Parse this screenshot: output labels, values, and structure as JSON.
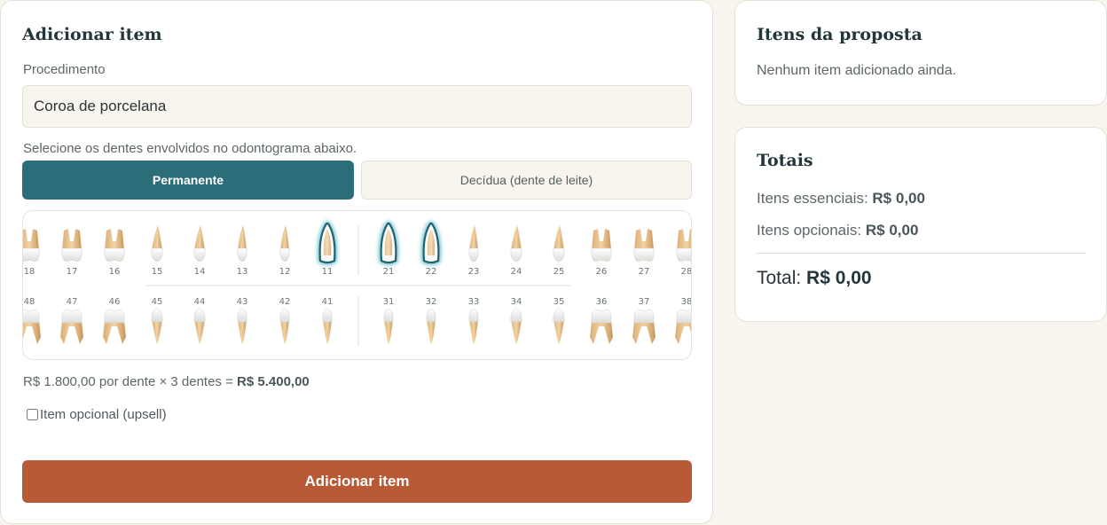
{
  "add_item": {
    "title": "Adicionar item",
    "procedure_label": "Procedimento",
    "procedure_value": "Coroa de porcelana",
    "instruction": "Selecione os dentes envolvidos no odontograma abaixo.",
    "tabs": [
      {
        "label": "Permanente",
        "active": true
      },
      {
        "label": "Decídua (dente de leite)",
        "active": false
      }
    ],
    "odontogram": {
      "upper_right": [
        "18",
        "17",
        "16",
        "15",
        "14",
        "13",
        "12",
        "11"
      ],
      "upper_left": [
        "21",
        "22",
        "23",
        "24",
        "25",
        "26",
        "27",
        "28"
      ],
      "lower_right": [
        "48",
        "47",
        "46",
        "45",
        "44",
        "43",
        "42",
        "41"
      ],
      "lower_left": [
        "31",
        "32",
        "33",
        "34",
        "35",
        "36",
        "37",
        "38"
      ],
      "selected": [
        "11",
        "21",
        "22"
      ]
    },
    "price_prefix": "R$ 1.800,00 por dente × 3 dentes = ",
    "price_total": "R$ 5.400,00",
    "optional_label": "Item opcional (upsell)",
    "optional_checked": false,
    "submit_label": "Adicionar item"
  },
  "proposal_items": {
    "title": "Itens da proposta",
    "empty_text": "Nenhum item adicionado ainda."
  },
  "totals": {
    "title": "Totais",
    "essential_label": "Itens essenciais: ",
    "essential_value": "R$ 0,00",
    "optional_label": "Itens opcionais: ",
    "optional_value": "R$ 0,00",
    "total_label": "Total: ",
    "total_value": "R$ 0,00"
  },
  "colors": {
    "primary": "#2b6e7a",
    "accent": "#b85a35",
    "background": "#f8f5ef",
    "selected_outline": "#1f6372"
  }
}
